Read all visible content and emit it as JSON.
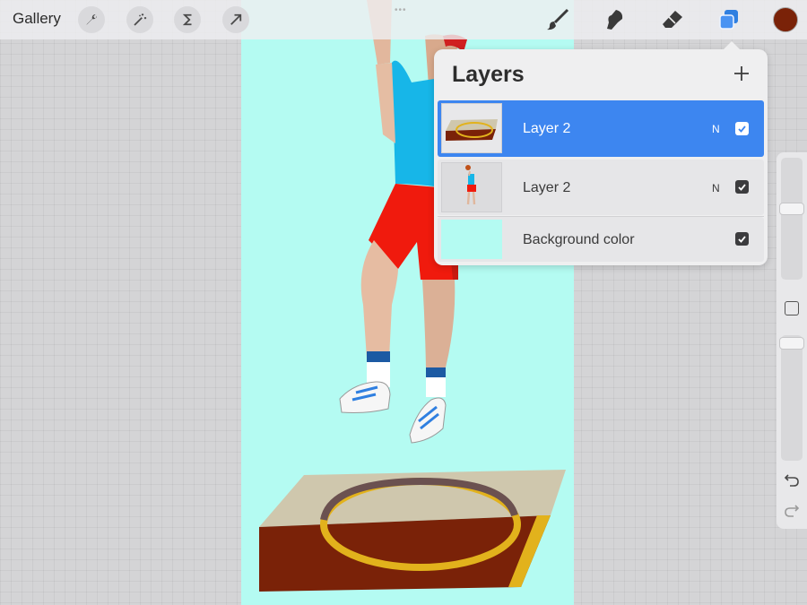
{
  "topbar": {
    "gallery_label": "Gallery",
    "left_tools": [
      "wrench-icon",
      "magic-wand-icon",
      "selection-s-icon",
      "transform-arrow-icon"
    ],
    "right_tools": [
      "brush-icon",
      "smudge-icon",
      "eraser-icon",
      "layers-icon"
    ],
    "current_color": "#7a2208"
  },
  "layers": {
    "title": "Layers",
    "add_icon": "plus-icon",
    "items": [
      {
        "name": "Layer 2",
        "blend": "N",
        "visible": true,
        "selected": true,
        "thumb": "court"
      },
      {
        "name": "Layer 2",
        "blend": "N",
        "visible": true,
        "selected": false,
        "thumb": "player"
      },
      {
        "name": "Background color",
        "blend": "",
        "visible": true,
        "selected": false,
        "thumb": "background"
      }
    ]
  },
  "sidebar": {
    "undo_icon": "undo-icon",
    "redo_icon": "redo-icon"
  },
  "colors": {
    "accent": "#3d86f0",
    "canvas": "#b4fbf2",
    "court_wood": "#7a2208",
    "court_tan": "#cfc7ad",
    "court_line": "#e2b21c"
  }
}
